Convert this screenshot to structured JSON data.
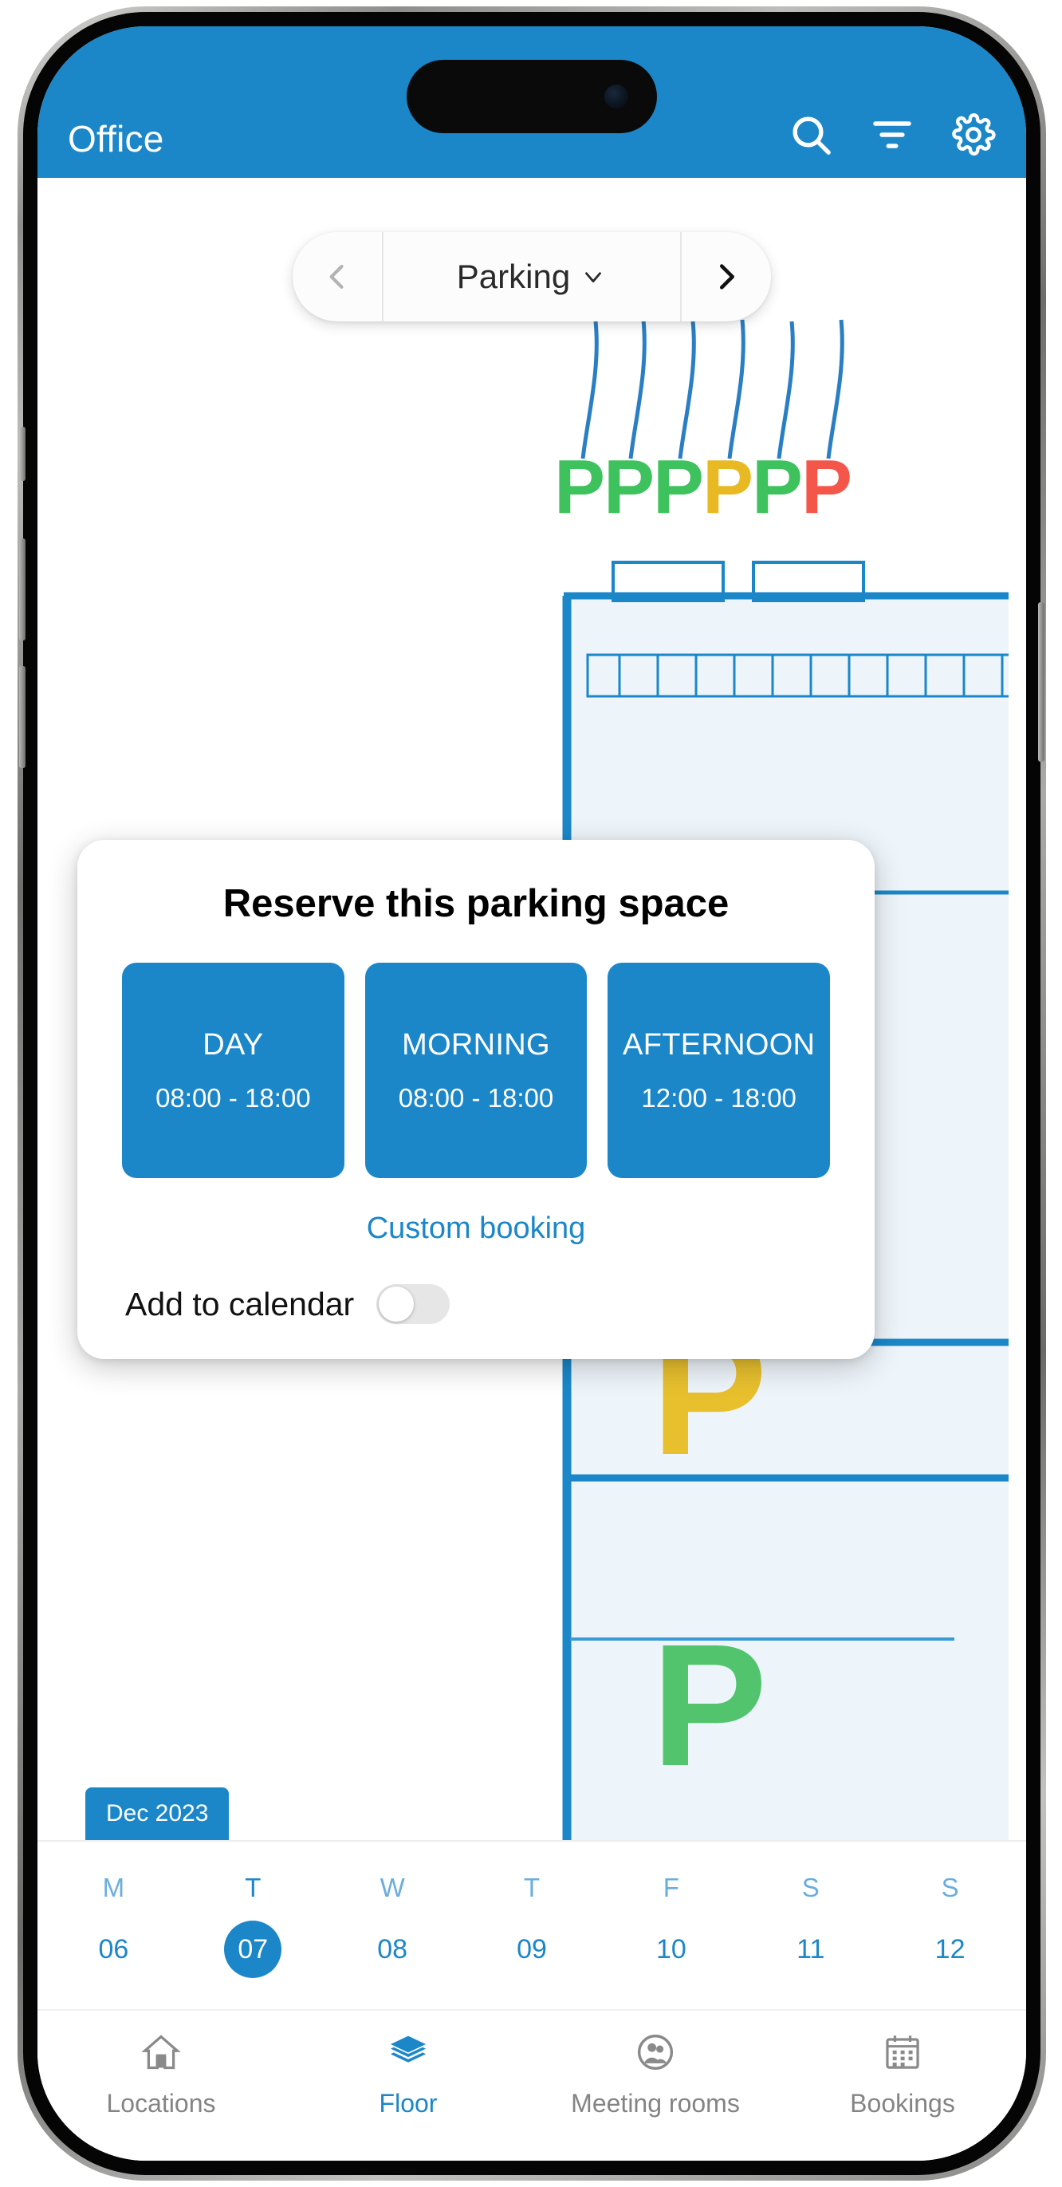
{
  "header": {
    "title": "Office",
    "icons": [
      {
        "name": "search-icon",
        "label": "Search"
      },
      {
        "name": "filter-icon",
        "label": "Filter"
      },
      {
        "name": "gear-icon",
        "label": "Settings"
      }
    ],
    "background_color": "#1b87c9"
  },
  "floor_selector": {
    "prev_label": "Previous floor",
    "current": "Parking",
    "next_label": "Next floor",
    "chevron_down_icon": "chevron-down-icon"
  },
  "map": {
    "legend_markers": [
      {
        "status": "available",
        "color": "#3ec25d"
      },
      {
        "status": "available",
        "color": "#3ec25d"
      },
      {
        "status": "available",
        "color": "#3ec25d"
      },
      {
        "status": "occupied",
        "color": "#e8b923"
      },
      {
        "status": "available",
        "color": "#3ec25d"
      },
      {
        "status": "unavailable",
        "color": "#f4564a"
      }
    ],
    "spaces": [
      {
        "label": "P",
        "color": "#3ec25d",
        "selected": true,
        "has_charger": true
      },
      {
        "label": "P",
        "color": "#e8b923",
        "selected": false,
        "has_charger": false
      },
      {
        "label": "P",
        "color": "#3ec25d",
        "selected": false,
        "has_charger": false
      }
    ],
    "selection_ring_color": "#e8b923",
    "charger_icon": "lightning-bolt-icon",
    "wall_color": "#1b87c9",
    "room_fill": "#eef5fa"
  },
  "modal": {
    "title": "Reserve this parking space",
    "slots": [
      {
        "label": "DAY",
        "time": "08:00 - 18:00"
      },
      {
        "label": "MORNING",
        "time": "08:00 - 18:00"
      },
      {
        "label": "AFTERNOON",
        "time": "12:00 - 18:00"
      }
    ],
    "custom_booking_label": "Custom booking",
    "calendar_label": "Add to calendar",
    "calendar_toggle_on": false,
    "accent_color": "#1b87c9"
  },
  "month_chip": {
    "label": "Dec 2023"
  },
  "dates": [
    {
      "dow": "M",
      "day": "06",
      "selected": false
    },
    {
      "dow": "T",
      "day": "07",
      "selected": true
    },
    {
      "dow": "W",
      "day": "08",
      "selected": false
    },
    {
      "dow": "T",
      "day": "09",
      "selected": false
    },
    {
      "dow": "F",
      "day": "10",
      "selected": false
    },
    {
      "dow": "S",
      "day": "11",
      "selected": false
    },
    {
      "dow": "S",
      "day": "12",
      "selected": false
    }
  ],
  "tabs": [
    {
      "label": "Locations",
      "icon": "home-icon",
      "active": false
    },
    {
      "label": "Floor",
      "icon": "layers-icon",
      "active": true
    },
    {
      "label": "Meeting rooms",
      "icon": "people-icon",
      "active": false
    },
    {
      "label": "Bookings",
      "icon": "calendar-icon",
      "active": false
    }
  ]
}
